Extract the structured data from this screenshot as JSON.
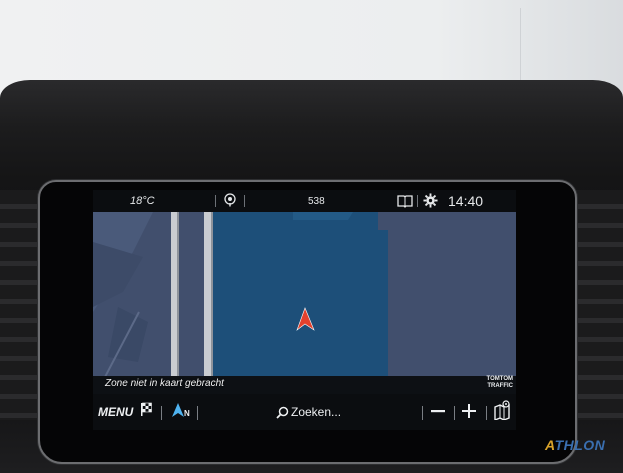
{
  "status_bar": {
    "temperature": "18°C",
    "center_value": "538",
    "time": "14:40",
    "icons": [
      "voice-assistant-icon",
      "book-icon",
      "gear-icon"
    ]
  },
  "map": {
    "zone_message": "Zone niet in kaart gebracht",
    "traffic_provider_line1": "TOMTOM",
    "traffic_provider_line2": "TRAFFIC",
    "vehicle_icon": "vehicle-position-arrow-icon",
    "colors": {
      "land": "#414f6d",
      "water": "#1d4f79",
      "vehicle": "#e2412d"
    }
  },
  "bottom_bar": {
    "menu_label": "MENU",
    "nav_mode_label": "N",
    "search_label": "Zoeken...",
    "icons": [
      "destination-flag-icon",
      "north-arrow-icon",
      "search-icon",
      "zoom-out-icon",
      "zoom-in-icon",
      "map-settings-icon"
    ]
  },
  "watermark": {
    "text_a": "A",
    "text_b": "THLON"
  }
}
